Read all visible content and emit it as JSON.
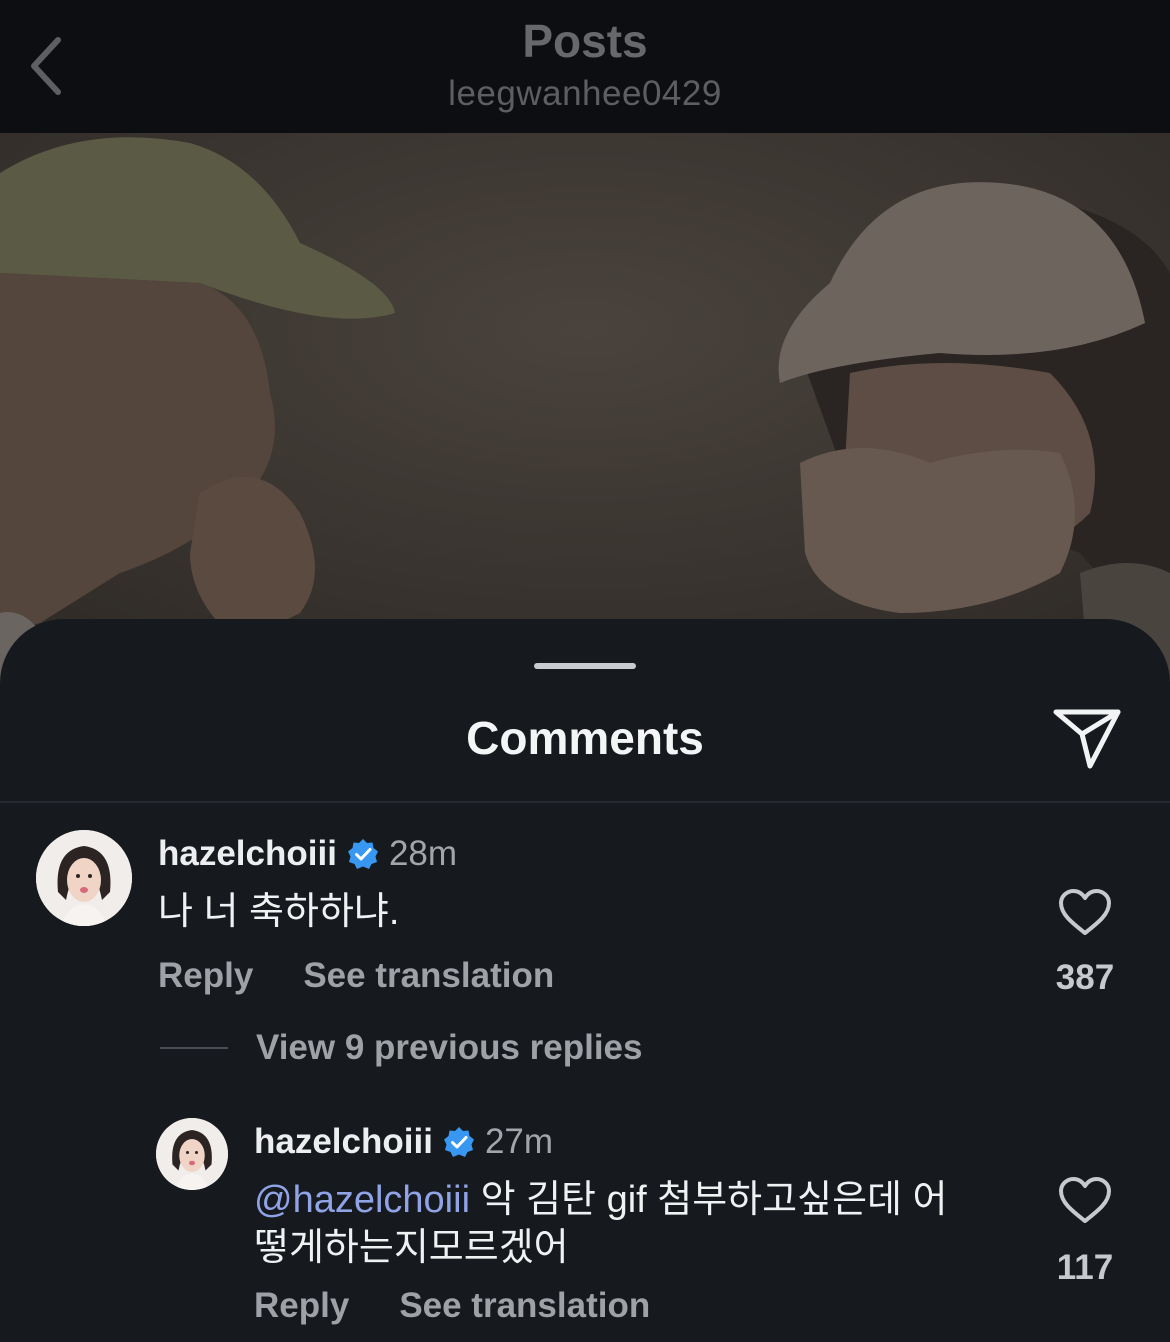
{
  "header": {
    "title": "Posts",
    "subtitle": "leegwanhee0429"
  },
  "sheet": {
    "title": "Comments"
  },
  "comments": [
    {
      "username": "hazelchoiii",
      "time": "28m",
      "text": "나 너 축하하냐.",
      "reply_label": "Reply",
      "translate_label": "See translation",
      "likes": "387"
    }
  ],
  "view_replies": "View 9 previous replies",
  "replies": [
    {
      "username": "hazelchoiii",
      "time": "27m",
      "mention": "@hazelchoiii",
      "text_line1": "악 김탄 gif 첨부하고싶은데 어",
      "text_line2": "떻게하는지모르겠어",
      "reply_label": "Reply",
      "translate_label": "See translation",
      "likes": "117"
    }
  ],
  "colors": {
    "verified": "#3897f0",
    "mention": "#8fa3e6",
    "sheet_bg": "#16191e"
  },
  "icons": [
    "chevron-left-icon",
    "send-icon",
    "verified-badge-icon",
    "heart-icon"
  ]
}
